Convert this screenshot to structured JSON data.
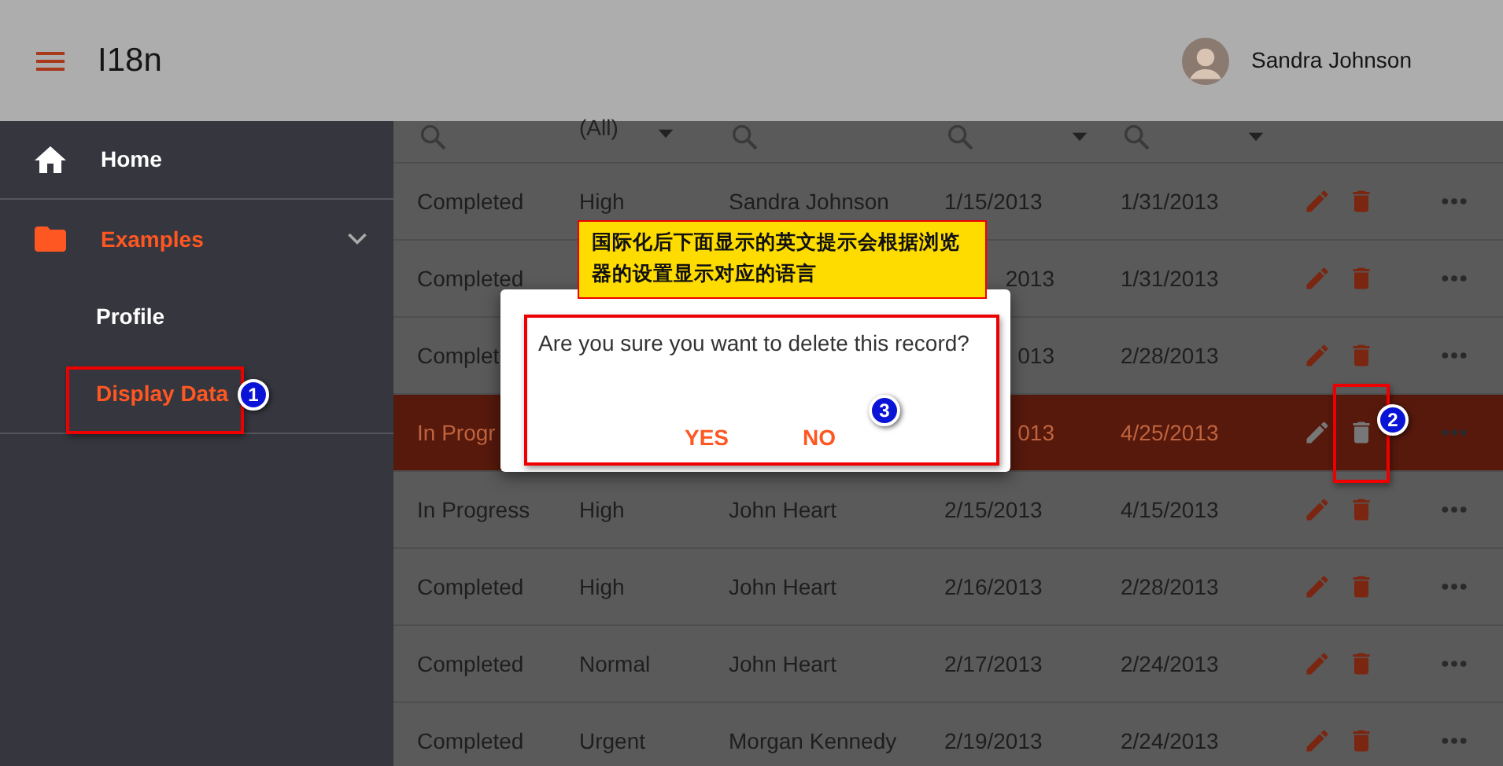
{
  "header": {
    "title": "I18n",
    "user": "Sandra Johnson"
  },
  "sidebar": {
    "items": [
      {
        "label": "Home",
        "selected": false
      },
      {
        "label": "Examples",
        "selected": true,
        "expanded": true,
        "children": [
          {
            "label": "Profile",
            "selected": false
          },
          {
            "label": "Display Data",
            "selected": true
          }
        ]
      }
    ]
  },
  "table": {
    "filters": [
      {
        "kind": "search"
      },
      {
        "kind": "select",
        "value": "(All)"
      },
      {
        "kind": "search"
      },
      {
        "kind": "search-select"
      },
      {
        "kind": "search-select"
      }
    ],
    "rows": [
      {
        "selected": false,
        "cells": [
          "Completed",
          "High",
          "Sandra Johnson",
          "1/15/2013",
          "1/31/2013"
        ]
      },
      {
        "selected": false,
        "cells": [
          "Completed",
          "",
          "",
          "2013",
          "1/31/2013"
        ]
      },
      {
        "selected": false,
        "cells": [
          "Complet",
          "",
          "",
          "013",
          "2/28/2013"
        ]
      },
      {
        "selected": true,
        "cells": [
          "In Progr",
          "",
          "",
          "013",
          "4/25/2013"
        ]
      },
      {
        "selected": false,
        "cells": [
          "In Progress",
          "High",
          "John Heart",
          "2/15/2013",
          "4/15/2013"
        ]
      },
      {
        "selected": false,
        "cells": [
          "Completed",
          "High",
          "John Heart",
          "2/16/2013",
          "2/28/2013"
        ]
      },
      {
        "selected": false,
        "cells": [
          "Completed",
          "Normal",
          "John Heart",
          "2/17/2013",
          "2/24/2013"
        ]
      },
      {
        "selected": false,
        "cells": [
          "Completed",
          "Urgent",
          "Morgan Kennedy",
          "2/19/2013",
          "2/24/2013"
        ]
      }
    ]
  },
  "dialog": {
    "message": "Are you sure you want to delete this record?",
    "buttons": [
      "YES",
      "NO"
    ]
  },
  "annotations": {
    "callout": "国际化后下面显示的英文提示会根据浏览器的设置显示对应的语言",
    "markers": [
      "1",
      "2",
      "3"
    ]
  }
}
